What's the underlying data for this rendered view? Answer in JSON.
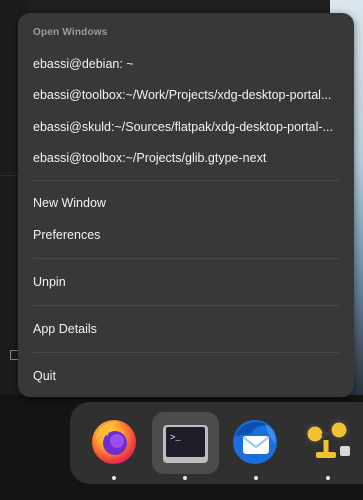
{
  "menu": {
    "section_title": "Open Windows",
    "windows": [
      "ebassi@debian: ~",
      "ebassi@toolbox:~/Work/Projects/xdg-desktop-portal...",
      "ebassi@skuld:~/Sources/flatpak/xdg-desktop-portal-...",
      "ebassi@toolbox:~/Projects/glib.gtype-next"
    ],
    "new_window": "New Window",
    "preferences": "Preferences",
    "unpin": "Unpin",
    "app_details": "App Details",
    "quit": "Quit"
  },
  "dock": {
    "apps": [
      {
        "icon": "firefox-icon",
        "running": true
      },
      {
        "icon": "terminal-icon",
        "running": true,
        "focused": true
      },
      {
        "icon": "thunderbird-icon",
        "running": true
      },
      {
        "icon": "dconf-editor-icon",
        "running": true
      }
    ],
    "terminal_prompt": ">_"
  },
  "colors": {
    "menu_bg": "#383838",
    "dock_bg": "#303030",
    "separator": "#4a4a4a"
  }
}
